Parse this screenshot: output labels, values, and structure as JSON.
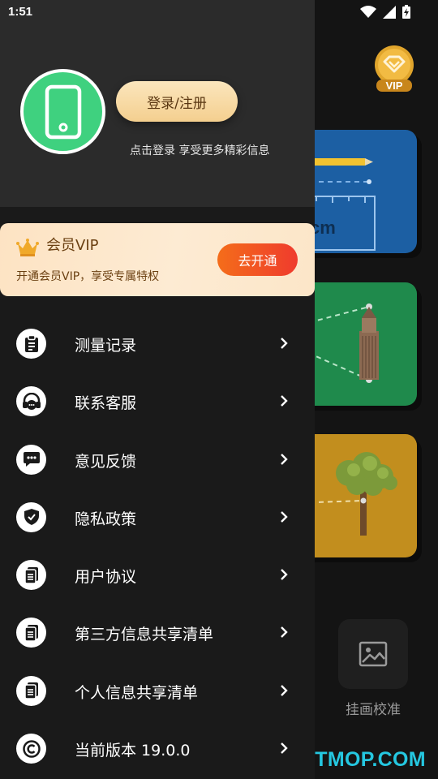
{
  "status_bar": {
    "time": "1:51"
  },
  "profile": {
    "login_button_label": "登录/注册",
    "hint": "点击登录 享受更多精彩信息"
  },
  "vip": {
    "title": "会员VIP",
    "description": "开通会员VIP，享受专属特权",
    "open_button_label": "去开通",
    "badge_text": "VIP"
  },
  "menu": {
    "items": [
      {
        "label": "测量记录",
        "icon": "clipboard-icon"
      },
      {
        "label": "联系客服",
        "icon": "headset-icon"
      },
      {
        "label": "意见反馈",
        "icon": "chat-bubble-icon"
      },
      {
        "label": "隐私政策",
        "icon": "shield-check-icon"
      },
      {
        "label": "用户协议",
        "icon": "document-icon"
      },
      {
        "label": "第三方信息共享清单",
        "icon": "document-icon"
      },
      {
        "label": "个人信息共享清单",
        "icon": "document-icon"
      },
      {
        "label": "当前版本 19.0.0",
        "icon": "copyright-icon"
      }
    ]
  },
  "background": {
    "tile_label": "挂画校准",
    "ruler_unit_text": "cm",
    "watermark": "ITMOP.COM"
  },
  "colors": {
    "avatar": "#3fd17f",
    "vip_button_start": "#f46d1a",
    "vip_button_end": "#ef3b2d",
    "drawer": "#1a1a1a",
    "watermark": "#25c7e0"
  }
}
